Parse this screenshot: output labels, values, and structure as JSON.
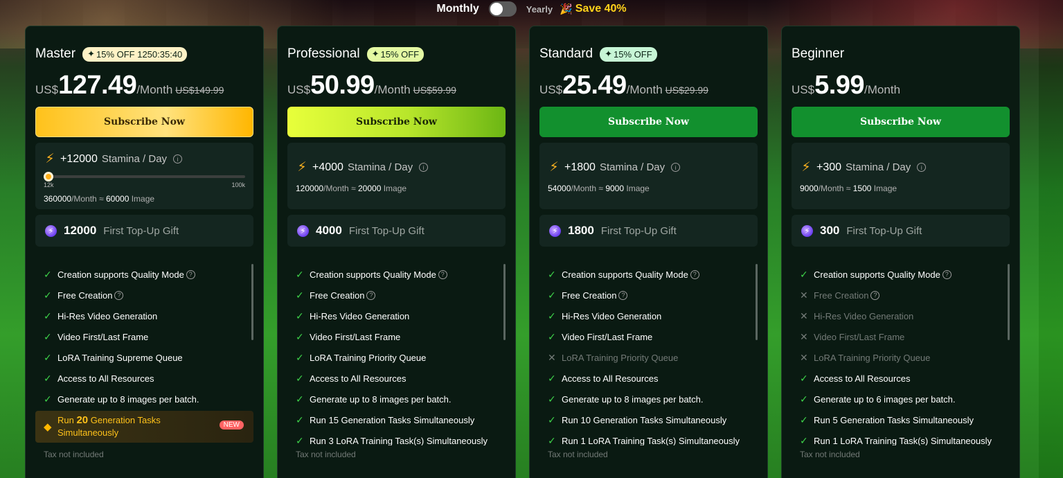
{
  "toggle": {
    "monthly_label": "Monthly",
    "yearly_label": "Yearly",
    "save_label": "Save 40%",
    "save_icon": "party-popper-icon",
    "state": "monthly"
  },
  "colors": {
    "gold": "#ffc21b",
    "lime": "#b8e62b",
    "green": "#12902e",
    "check": "#3ed24a"
  },
  "plans": [
    {
      "name": "Master",
      "badge": "15% OFF 1250:35:40",
      "currency": "US$",
      "price": "127.49",
      "period": "/Month",
      "old_price": "US$149.99",
      "button": "Subscribe Now",
      "stamina": "+12000",
      "stamina_label": "Stamina / Day",
      "slider_min": "12k",
      "slider_max": "100k",
      "monthly_amount": "360000",
      "monthly_sep": "/Month ≈ ",
      "image_count": "60000",
      "image_label": "Image",
      "gift_amount": "12000",
      "gift_label": "First Top-Up Gift",
      "features": [
        "Creation supports Quality Mode",
        "Free Creation",
        "Hi-Res Video Generation",
        "Video First/Last Frame",
        "LoRA Training Supreme Queue",
        "Access to All Resources",
        "Generate up to 8 images per batch."
      ],
      "highlight_pre": "Run ",
      "highlight_num": "20",
      "highlight_post": " Generation Tasks Simultaneously",
      "new_badge": "NEW",
      "tax": "Tax not included"
    },
    {
      "name": "Professional",
      "badge": "15% OFF",
      "currency": "US$",
      "price": "50.99",
      "period": "/Month",
      "old_price": "US$59.99",
      "button": "Subscribe Now",
      "stamina": "+4000",
      "stamina_label": "Stamina / Day",
      "monthly_amount": "120000",
      "monthly_sep": "/Month ≈ ",
      "image_count": "20000",
      "image_label": "Image",
      "gift_amount": "4000",
      "gift_label": "First Top-Up Gift",
      "features": [
        "Creation supports Quality Mode",
        "Free Creation",
        "Hi-Res Video Generation",
        "Video First/Last Frame",
        "LoRA Training Priority Queue",
        "Access to All Resources",
        "Generate up to 8 images per batch.",
        "Run 15 Generation Tasks Simultaneously",
        "Run 3 LoRA Training Task(s) Simultaneously"
      ],
      "tax": "Tax not included"
    },
    {
      "name": "Standard",
      "badge": "15% OFF",
      "currency": "US$",
      "price": "25.49",
      "period": "/Month",
      "old_price": "US$29.99",
      "button": "Subscribe Now",
      "stamina": "+1800",
      "stamina_label": "Stamina / Day",
      "monthly_amount": "54000",
      "monthly_sep": "/Month ≈ ",
      "image_count": "9000",
      "image_label": "Image",
      "gift_amount": "1800",
      "gift_label": "First Top-Up Gift",
      "features": [
        "Creation supports Quality Mode",
        "Free Creation",
        "Hi-Res Video Generation",
        "Video First/Last Frame",
        "LoRA Training Priority Queue",
        "Access to All Resources",
        "Generate up to 8 images per batch.",
        "Run 10 Generation Tasks Simultaneously",
        "Run 1 LoRA Training Task(s) Simultaneously"
      ],
      "tax": "Tax not included"
    },
    {
      "name": "Beginner",
      "currency": "US$",
      "price": "5.99",
      "period": "/Month",
      "button": "Subscribe Now",
      "stamina": "+300",
      "stamina_label": "Stamina / Day",
      "monthly_amount": "9000",
      "monthly_sep": "/Month ≈ ",
      "image_count": "1500",
      "image_label": "Image",
      "gift_amount": "300",
      "gift_label": "First Top-Up Gift",
      "features": [
        "Creation supports Quality Mode",
        "Free Creation",
        "Hi-Res Video Generation",
        "Video First/Last Frame",
        "LoRA Training Priority Queue",
        "Access to All Resources",
        "Generate up to 6 images per batch.",
        "Run 5 Generation Tasks Simultaneously",
        "Run 1 LoRA Training Task(s) Simultaneously"
      ],
      "tax": "Tax not included"
    }
  ]
}
